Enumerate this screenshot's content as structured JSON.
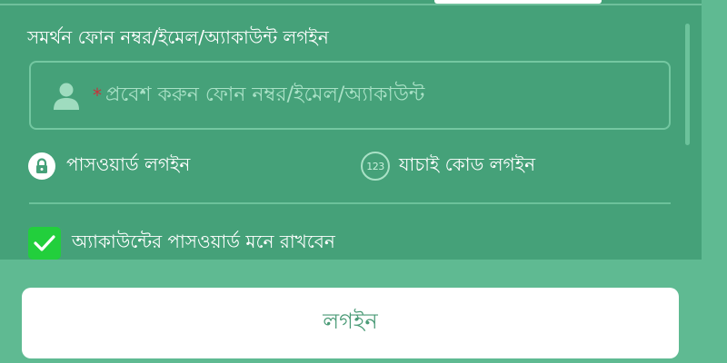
{
  "colors": {
    "panel": "#45a179",
    "background": "#5fba92",
    "checkbox": "#22cf3c",
    "required_star": "#c7323a",
    "button_text": "#4a9a76"
  },
  "login_form": {
    "section_label": "সমর্থন ফোন নম্বর/ইমেল/অ্যাকাউন্ট লগইন",
    "account_input": {
      "required_marker": "*",
      "placeholder": "প্রবেশ করুন ফোন নম্বর/ইমেল/অ্যাকাউন্ট",
      "value": "",
      "icon": "user-icon"
    },
    "options": [
      {
        "label": "পাসওয়ার্ড লগইন",
        "icon": "lock-icon"
      },
      {
        "label": "যাচাই কোড লগইন",
        "icon": "code-icon",
        "icon_text": "123"
      }
    ],
    "remember_password": {
      "label": "অ্যাকাউন্টের পাসওয়ার্ড মনে রাখবেন",
      "checked": true
    },
    "login_button": "লগইন"
  }
}
